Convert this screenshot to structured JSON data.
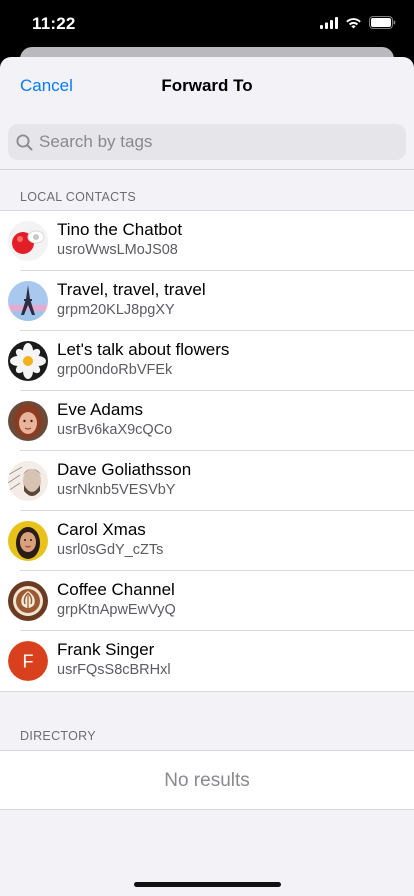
{
  "status": {
    "time": "11:22"
  },
  "nav": {
    "cancel_label": "Cancel",
    "title": "Forward To"
  },
  "search": {
    "placeholder": "Search by tags",
    "value": ""
  },
  "local_contacts": {
    "header": "LOCAL CONTACTS",
    "items": [
      {
        "name": "Tino the Chatbot",
        "id": "usroWwsLMoJS08",
        "avatar_icon": "chatbot-avatar-icon"
      },
      {
        "name": "Travel, travel, travel",
        "id": "grpm20KLJ8pgXY",
        "avatar_icon": "eiffel-tower-avatar-icon"
      },
      {
        "name": "Let's talk about flowers",
        "id": "grp00ndoRbVFEk",
        "avatar_icon": "flower-avatar-icon"
      },
      {
        "name": "Eve Adams",
        "id": "usrBv6kaX9cQCo",
        "avatar_icon": "person-avatar-icon"
      },
      {
        "name": "Dave Goliathsson",
        "id": "usrNknb5VESVbY",
        "avatar_icon": "person-avatar-icon"
      },
      {
        "name": "Carol Xmas",
        "id": "usrl0sGdY_cZTs",
        "avatar_icon": "person-avatar-icon"
      },
      {
        "name": "Coffee Channel",
        "id": "grpKtnApwEwVyQ",
        "avatar_icon": "latte-art-avatar-icon"
      },
      {
        "name": "Frank Singer",
        "id": "usrFQsS8cBRHxl",
        "avatar_icon": "letter-avatar-icon",
        "initial": "F"
      }
    ]
  },
  "directory": {
    "header": "DIRECTORY",
    "empty_text": "No results"
  },
  "colors": {
    "accent": "#0a7aff",
    "letter_avatar": "#d9411e",
    "background": "#f2f2f7"
  }
}
